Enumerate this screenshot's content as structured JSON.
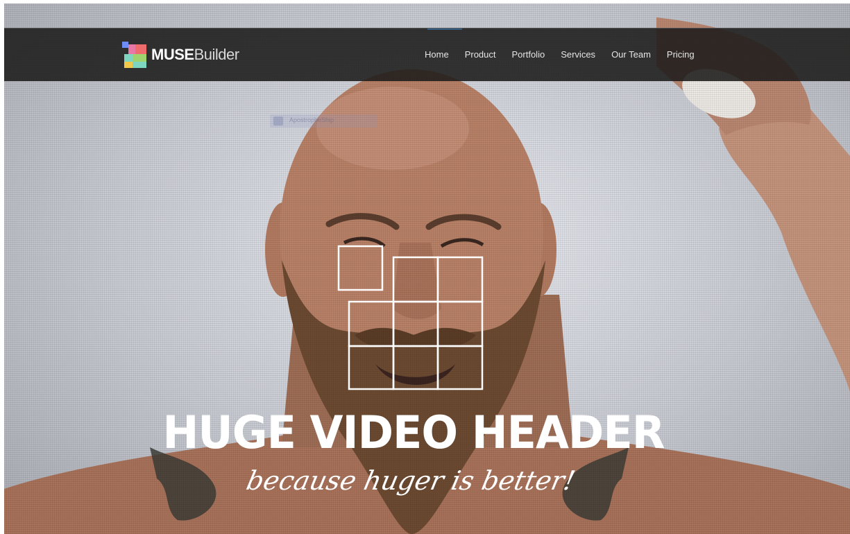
{
  "brand": {
    "logo_bold": "MUSE",
    "logo_light": "Builder",
    "logo_colors": [
      "#6f8df7",
      "#f06b6b",
      "#f2c84b",
      "#7fd6c0",
      "#e879a7",
      "#9fd36e"
    ]
  },
  "nav": {
    "items": [
      {
        "label": "Home"
      },
      {
        "label": "Product"
      },
      {
        "label": "Portfolio"
      },
      {
        "label": "Services"
      },
      {
        "label": "Our Team"
      },
      {
        "label": "Pricing"
      }
    ]
  },
  "hero": {
    "headline": "HUGE VIDEO HEADER",
    "tagline": "because huger is better!",
    "ghost_badge": "ApostropheShip",
    "grid_icon": "grid-squares-icon"
  },
  "colors": {
    "nav_bg": "#1c1b1a",
    "nav_text": "#e6e6e6",
    "headline": "#ffffff",
    "skin": "#b37c63",
    "beard": "#6b4a31"
  }
}
